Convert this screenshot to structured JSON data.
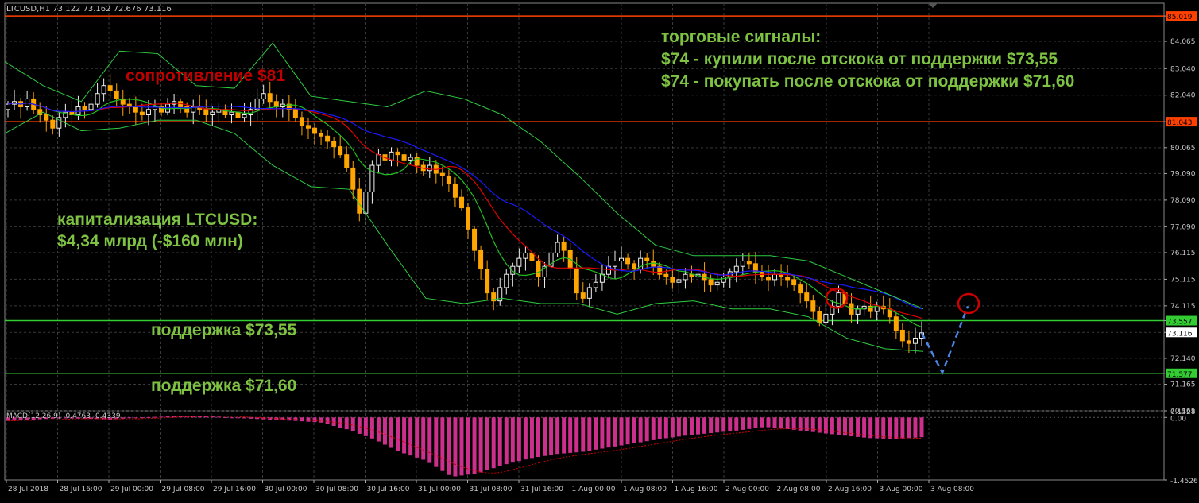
{
  "header": {
    "symbol_info": "LTCUSD,H1  73.122 73.162 72.676 73.116"
  },
  "macd_header": "MACD(12,26,9) -0.4763 -0.4339",
  "annotations": {
    "resistance": "сопротивление $81",
    "signals_title": "торговые сигналы:",
    "signal_1": "$74 - купили после отскока от поддержки $73,55",
    "signal_2": "$74 - покупать после отскока от поддержки $71,60",
    "cap_line1": "капитализация LTCUSD:",
    "cap_line2": "$4,34 млрд (-$160 млн)",
    "support_1": "поддержка $73,55",
    "support_2": "поддержка $71,60"
  },
  "colors": {
    "background": "#000000",
    "grid": "#3a3a3a",
    "bull": "#f0f0f0",
    "bear": "#ffa500",
    "resistance_line": "#ff4000",
    "support_line": "#33cc33",
    "sma_blue": "#1a1aff",
    "sma_red": "#e00000",
    "sma_green": "#22c022",
    "bollinger": "#2ecc40",
    "macd_hist": "#cc2f8c",
    "macd_signal": "#cc0000",
    "forecast": "#4a86e8",
    "circle": "#cc0000"
  },
  "chart_data": {
    "type": "candlestick",
    "timeframe": "H1",
    "ylim": [
      70.165,
      85.5
    ],
    "price_ticks": [
      "85.019",
      "84.065",
      "83.040",
      "82.040",
      "81.043",
      "80.065",
      "79.090",
      "78.090",
      "77.090",
      "76.115",
      "75.115",
      "74.115",
      "73.557",
      "73.116",
      "72.140",
      "71.577",
      "71.165",
      "70.165"
    ],
    "price_labels": [
      {
        "value": 85.019,
        "text": "85.019",
        "bg": "#ff4000",
        "fg": "#000000"
      },
      {
        "value": 81.043,
        "text": "81.043",
        "bg": "#ff4000",
        "fg": "#000000"
      },
      {
        "value": 73.557,
        "text": "73.557",
        "bg": "#33cc33",
        "fg": "#000000"
      },
      {
        "value": 73.116,
        "text": "73.116",
        "bg": "#ffffff",
        "fg": "#000000"
      },
      {
        "value": 71.577,
        "text": "71.577",
        "bg": "#33cc33",
        "fg": "#000000"
      }
    ],
    "time_labels": [
      "28 Jul 2018",
      "28 Jul 16:00",
      "29 Jul 00:00",
      "29 Jul 08:00",
      "29 Jul 16:00",
      "30 Jul 00:00",
      "30 Jul 08:00",
      "30 Jul 16:00",
      "31 Jul 00:00",
      "31 Jul 08:00",
      "31 Jul 16:00",
      "1 Aug 00:00",
      "1 Aug 08:00",
      "1 Aug 16:00",
      "2 Aug 00:00",
      "2 Aug 08:00",
      "2 Aug 16:00",
      "3 Aug 00:00",
      "3 Aug 08:00"
    ],
    "levels": {
      "resistance": [
        85.019,
        81.043
      ],
      "support": [
        73.557,
        71.577
      ]
    },
    "close_path": [
      81.7,
      81.8,
      81.6,
      81.9,
      81.5,
      81.3,
      81.1,
      80.8,
      81.2,
      81.4,
      81.3,
      81.6,
      81.5,
      81.7,
      82.1,
      82.4,
      82.2,
      81.9,
      81.7,
      81.6,
      81.4,
      81.3,
      81.5,
      81.6,
      81.4,
      81.7,
      81.8,
      81.6,
      81.4,
      81.6,
      81.5,
      81.3,
      81.4,
      81.5,
      81.3,
      81.4,
      81.2,
      81.3,
      81.5,
      81.9,
      82.1,
      81.8,
      81.6,
      81.7,
      81.5,
      81.2,
      80.9,
      80.8,
      80.6,
      80.5,
      80.3,
      80.1,
      79.8,
      79.3,
      78.5,
      77.6,
      78.4,
      79.4,
      79.8,
      79.6,
      79.9,
      79.8,
      79.6,
      79.7,
      79.4,
      79.2,
      79.4,
      79.1,
      79.0,
      78.7,
      78.2,
      77.8,
      77.0,
      76.2,
      75.5,
      74.6,
      74.3,
      74.8,
      75.3,
      75.6,
      75.9,
      76.1,
      75.8,
      75.2,
      75.6,
      76.1,
      76.5,
      76.2,
      75.5,
      74.6,
      74.4,
      74.8,
      75.0,
      75.3,
      75.6,
      75.8,
      75.9,
      75.7,
      75.5,
      75.9,
      75.8,
      75.6,
      75.3,
      75.2,
      75.0,
      75.1,
      75.3,
      75.2,
      75.3,
      75.1,
      74.9,
      75.0,
      75.2,
      75.4,
      75.6,
      75.8,
      75.7,
      75.4,
      75.2,
      75.1,
      75.3,
      75.2,
      75.1,
      74.9,
      74.6,
      74.3,
      73.9,
      73.5,
      73.8,
      74.1,
      74.6,
      74.2,
      73.8,
      74.0,
      74.1,
      73.9,
      74.1,
      74.0,
      73.7,
      73.2,
      72.8,
      72.7,
      72.9,
      73.1
    ],
    "bands": {
      "upper": [
        83.3,
        82.4,
        81.8,
        83.7,
        83.6,
        82.4,
        82.3,
        84.0,
        82.0,
        81.8,
        81.6,
        82.2,
        81.9,
        81.3,
        80.3,
        79.0,
        77.6,
        76.4,
        76.0,
        76.0,
        76.0,
        75.8,
        75.2,
        74.6,
        74.0
      ],
      "lower": [
        80.6,
        81.4,
        80.7,
        80.8,
        81.1,
        81.1,
        80.6,
        79.4,
        78.6,
        78.5,
        76.4,
        74.4,
        74.2,
        74.4,
        74.2,
        74.2,
        73.8,
        74.2,
        74.3,
        74.0,
        74.0,
        73.7,
        72.9,
        72.5,
        72.4
      ]
    },
    "forecast_path": [
      73.1,
      71.6,
      74.1
    ],
    "macd": {
      "ylim": [
        -1.4526,
        0.1528
      ],
      "ticks": [
        "0.1528",
        "0.00",
        "-1.4526"
      ],
      "hist_envelope": [
        -0.08,
        -0.05,
        -0.02,
        -0.03,
        -0.05,
        0.0,
        0.02,
        0.04,
        0.02,
        -0.02,
        -0.05,
        -0.08,
        -0.12,
        -0.28,
        -0.5,
        -0.8,
        -1.0,
        -1.38,
        -1.3,
        -1.1,
        -0.95,
        -0.85,
        -0.8,
        -0.7,
        -0.6,
        -0.5,
        -0.42,
        -0.36,
        -0.3,
        -0.22,
        -0.28,
        -0.35,
        -0.42,
        -0.48,
        -0.5,
        -0.46
      ]
    }
  }
}
